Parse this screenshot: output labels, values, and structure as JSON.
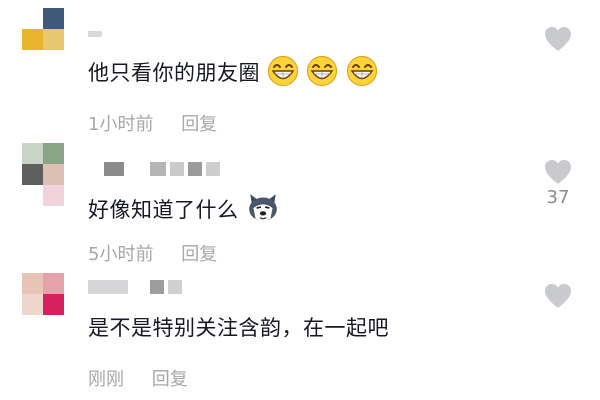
{
  "comments": [
    {
      "text": "他只看你的朋友圈",
      "emoji": [
        "grin-emoji",
        "grin-emoji",
        "grin-emoji"
      ],
      "time": "1小时前",
      "reply": "回复",
      "likes": ""
    },
    {
      "text": "好像知道了什么",
      "emoji": [
        "husky-emoji"
      ],
      "time": "5小时前",
      "reply": "回复",
      "likes": "37"
    },
    {
      "text": "是不是特别关注含韵，在一起吧",
      "emoji": [],
      "time": "刚刚",
      "reply": "回复",
      "likes": ""
    }
  ],
  "colors": {
    "text": "#161823",
    "meta": "#a6a7ab",
    "heart": "#c9cacd"
  }
}
